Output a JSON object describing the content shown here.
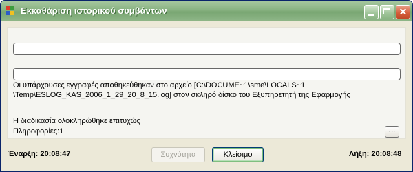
{
  "window": {
    "title": "Εκκαθάριση ιστορικού συμβάντων",
    "minimize_glyph": "",
    "maximize_glyph": "",
    "close_glyph": "✕"
  },
  "progress": {
    "bar1_value": 0,
    "bar2_value": 0
  },
  "message": {
    "line1": "Οι υπάρχουσες εγγραφές αποθηκεύθηκαν στο αρχείο [C:\\DOCUME~1\\sme\\LOCALS~1",
    "line2": "\\Temp\\ESLOG_KAS_2006_1_29_20_8_15.log]  στον  σκληρό δίσκο του  Εξυπηρετητή της Εφαρμογής",
    "status": "Η διαδικασία ολοκληρώθηκε επιτυχώς",
    "info": "Πληροφορίες:1",
    "more_label": "..."
  },
  "footer": {
    "start_label": "Έναρξη: 20:08:47",
    "end_label": "Λήξη: 20:08:48",
    "frequency_button": "Συχνότητα",
    "close_button": "Κλείσιμο"
  },
  "colors": {
    "titlebar": "#88b282",
    "close_button": "#d45c38",
    "window_bg": "#ece9d8"
  }
}
